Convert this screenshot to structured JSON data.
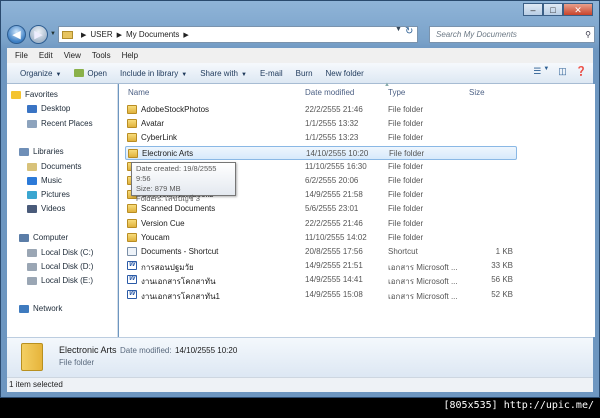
{
  "address": {
    "crumbs": [
      "USER",
      "My Documents"
    ]
  },
  "search": {
    "placeholder": "Search My Documents"
  },
  "menu": [
    "File",
    "Edit",
    "View",
    "Tools",
    "Help"
  ],
  "toolbar": {
    "organize": "Organize",
    "open": "Open",
    "include": "Include in library",
    "share": "Share with",
    "email": "E-mail",
    "burn": "Burn",
    "newfolder": "New folder"
  },
  "nav": {
    "favorites": "Favorites",
    "desktop": "Desktop",
    "recent": "Recent Places",
    "libraries": "Libraries",
    "documents": "Documents",
    "music": "Music",
    "pictures": "Pictures",
    "videos": "Videos",
    "computer": "Computer",
    "diskc": "Local Disk (C:)",
    "diskd": "Local Disk (D:)",
    "diske": "Local Disk (E:)",
    "network": "Network"
  },
  "columns": {
    "name": "Name",
    "date": "Date modified",
    "type": "Type",
    "size": "Size"
  },
  "files": [
    {
      "name": "AdobeStockPhotos",
      "date": "22/2/2555 21:46",
      "type": "File folder",
      "size": "",
      "icon": "folder"
    },
    {
      "name": "Avatar",
      "date": "1/1/2555 13:32",
      "type": "File folder",
      "size": "",
      "icon": "folder"
    },
    {
      "name": "CyberLink",
      "date": "1/1/2555 13:23",
      "type": "File folder",
      "size": "",
      "icon": "folder"
    },
    {
      "name": "Electronic Arts",
      "date": "14/10/2555 10:20",
      "type": "File folder",
      "size": "",
      "icon": "folder"
    },
    {
      "name": "",
      "date": "11/10/2555 16:30",
      "type": "File folder",
      "size": "",
      "icon": "folder"
    },
    {
      "name": "",
      "date": "6/2/2555 20:06",
      "type": "File folder",
      "size": "",
      "icon": "folder"
    },
    {
      "name": "OneNote Notebooks",
      "date": "14/9/2555 21:58",
      "type": "File folder",
      "size": "",
      "icon": "folder"
    },
    {
      "name": "Scanned Documents",
      "date": "5/6/2555 23:01",
      "type": "File folder",
      "size": "",
      "icon": "folder"
    },
    {
      "name": "Version Cue",
      "date": "22/2/2555 21:46",
      "type": "File folder",
      "size": "",
      "icon": "folder"
    },
    {
      "name": "Youcam",
      "date": "11/10/2555 14:02",
      "type": "File folder",
      "size": "",
      "icon": "folder"
    },
    {
      "name": "Documents - Shortcut",
      "date": "20/8/2555 17:56",
      "type": "Shortcut",
      "size": "1 KB",
      "icon": "shortcut"
    },
    {
      "name": "การสอนปฐมวัย",
      "date": "14/9/2555 21:51",
      "type": "เอกสาร Microsoft ...",
      "size": "33 KB",
      "icon": "doc"
    },
    {
      "name": "งานเอกสารโคกสาทัน",
      "date": "14/9/2555 14:41",
      "type": "เอกสาร Microsoft ...",
      "size": "56 KB",
      "icon": "doc"
    },
    {
      "name": "งานเอกสารโคกสาทัน1",
      "date": "14/9/2555 15:08",
      "type": "เอกสาร Microsoft ...",
      "size": "52 KB",
      "icon": "doc"
    }
  ],
  "tooltip": {
    "created": "Date created: 19/8/2555 9:56",
    "size": "Size: 879 MB",
    "folders": "Folders: เลขบัญชี 3"
  },
  "details": {
    "name": "Electronic Arts",
    "modified_label": "Date modified:",
    "modified_value": "14/10/2555 10:20",
    "type": "File folder"
  },
  "status": "1 item selected",
  "watermark": "[805x535] http://upic.me/"
}
